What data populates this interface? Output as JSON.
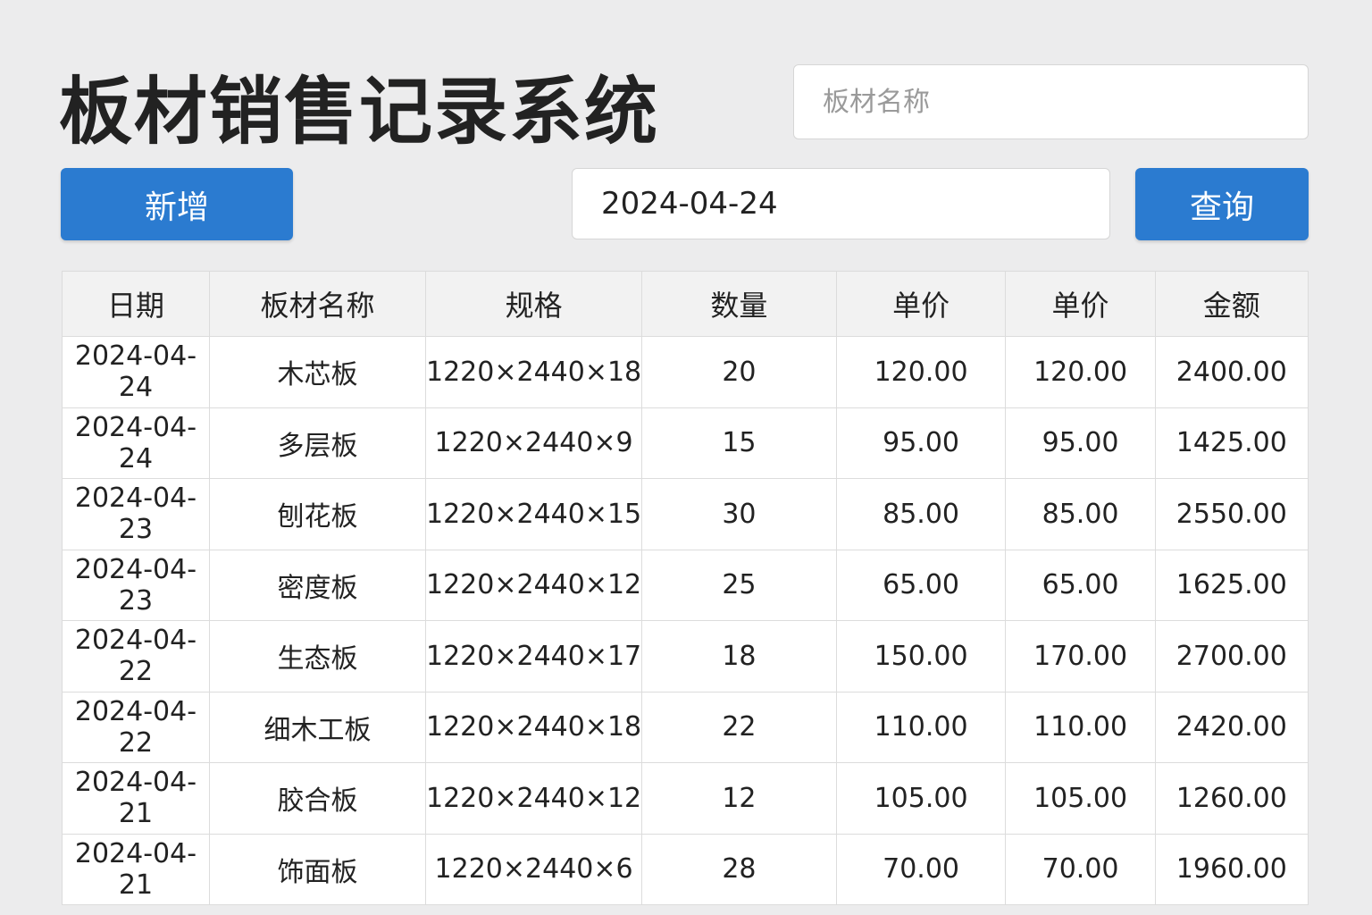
{
  "header": {
    "title": "板材销售记录系统",
    "search_placeholder": "板材名称"
  },
  "toolbar": {
    "add_label": "新增",
    "date_value": "2024-04-24",
    "query_label": "查询"
  },
  "table": {
    "columns": [
      "日期",
      "板材名称",
      "规格",
      "数量",
      "单价",
      "单价",
      "金额"
    ],
    "rows": [
      [
        "2024-04-24",
        "木芯板",
        "1220×2440×18",
        "20",
        "120.00",
        "120.00",
        "2400.00"
      ],
      [
        "2024-04-24",
        "多层板",
        "1220×2440×9",
        "15",
        "95.00",
        "95.00",
        "1425.00"
      ],
      [
        "2024-04-23",
        "刨花板",
        "1220×2440×15",
        "30",
        "85.00",
        "85.00",
        "2550.00"
      ],
      [
        "2024-04-23",
        "密度板",
        "1220×2440×12",
        "25",
        "65.00",
        "65.00",
        "1625.00"
      ],
      [
        "2024-04-22",
        "生态板",
        "1220×2440×17",
        "18",
        "150.00",
        "170.00",
        "2700.00"
      ],
      [
        "2024-04-22",
        "细木工板",
        "1220×2440×18",
        "22",
        "110.00",
        "110.00",
        "2420.00"
      ],
      [
        "2024-04-21",
        "胶合板",
        "1220×2440×12",
        "12",
        "105.00",
        "105.00",
        "1260.00"
      ],
      [
        "2024-04-21",
        "饰面板",
        "1220×2440×6",
        "28",
        "70.00",
        "70.00",
        "1960.00"
      ]
    ]
  }
}
